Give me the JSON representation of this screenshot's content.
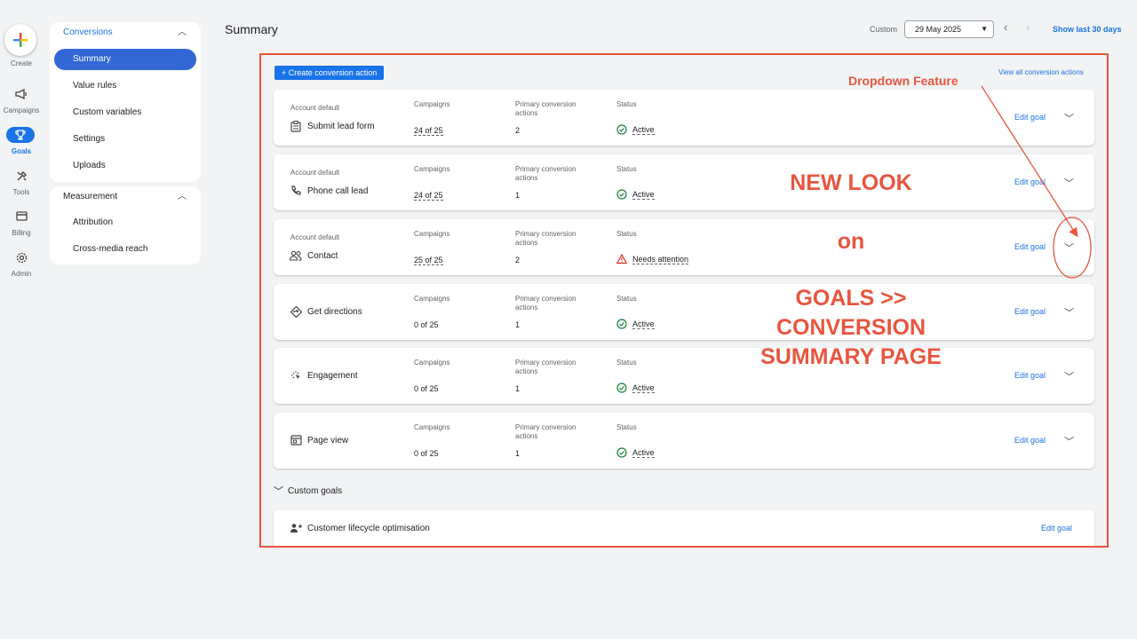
{
  "rail": {
    "create_label": "Create",
    "items": [
      {
        "label": "Campaigns",
        "icon": "megaphone-icon"
      },
      {
        "label": "Goals",
        "icon": "trophy-icon"
      },
      {
        "label": "Tools",
        "icon": "tools-icon"
      },
      {
        "label": "Billing",
        "icon": "card-icon"
      },
      {
        "label": "Admin",
        "icon": "gear-icon"
      }
    ]
  },
  "sidebar": {
    "conversions_title": "Conversions",
    "conversions_items": [
      "Summary",
      "Value rules",
      "Custom variables",
      "Settings",
      "Uploads"
    ],
    "measurement_title": "Measurement",
    "measurement_items": [
      "Attribution",
      "Cross-media reach"
    ]
  },
  "header": {
    "title": "Summary",
    "date_label": "Custom",
    "date_value": "29 May 2025",
    "show_last": "Show last 30 days"
  },
  "main": {
    "create_action": "+ Create conversion action",
    "view_all": "View all conversion actions",
    "col_campaigns": "Campaigns",
    "col_primary_1": "Primary conversion",
    "col_primary_2": "actions",
    "col_status": "Status",
    "edit_goal": "Edit goal",
    "goals": [
      {
        "account": "Account default",
        "name": "Submit lead form",
        "campaigns": "24 of 25",
        "primary": "2",
        "status": "Active"
      },
      {
        "account": "Account default",
        "name": "Phone call lead",
        "campaigns": "24 of 25",
        "primary": "1",
        "status": "Active"
      },
      {
        "account": "Account default",
        "name": "Contact",
        "campaigns": "25 of 25",
        "primary": "2",
        "status": "Needs attention"
      },
      {
        "account": "",
        "name": "Get directions",
        "campaigns": "0 of 25",
        "primary": "1",
        "status": "Active"
      },
      {
        "account": "",
        "name": "Engagement",
        "campaigns": "0 of 25",
        "primary": "1",
        "status": "Active"
      },
      {
        "account": "",
        "name": "Page view",
        "campaigns": "0 of 25",
        "primary": "1",
        "status": "Active"
      }
    ],
    "custom_goals": "Custom goals",
    "lifecycle": "Customer lifecycle optimisation"
  },
  "annotations": {
    "dropdown_feature": "Dropdown Feature",
    "new_look": "NEW LOOK",
    "on": "on",
    "goals_line1": "GOALS >>",
    "goals_line2": "CONVERSION",
    "goals_line3": "SUMMARY PAGE",
    "color": "#e8553f"
  }
}
